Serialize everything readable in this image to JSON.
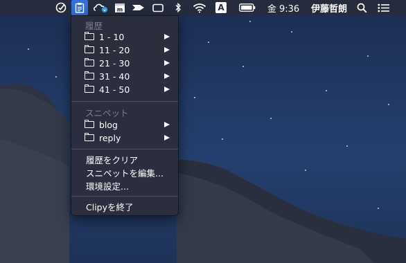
{
  "menubar": {
    "clock": "金 9:36",
    "user": "伊藤哲朗",
    "icons": [
      "checkmark-circle-icon",
      "clipboard-icon",
      "creative-cloud-icon",
      "calendar-icon",
      "arrow-icon",
      "window-icon",
      "bluetooth-icon",
      "wifi-icon",
      "input-method-icon",
      "battery-icon",
      "search-icon",
      "list-icon"
    ],
    "input_method_label": "A",
    "accent": "#2f6fde"
  },
  "menu": {
    "history_header": "履歴",
    "history_items": [
      "1 - 10",
      "11 - 20",
      "21 - 30",
      "31 - 40",
      "41 - 50"
    ],
    "snippet_header": "スニペット",
    "snippet_items": [
      "blog",
      "reply"
    ],
    "actions": [
      "履歴をクリア",
      "スニペットを編集...",
      "環境設定..."
    ],
    "quit": "Clipyを終了"
  }
}
